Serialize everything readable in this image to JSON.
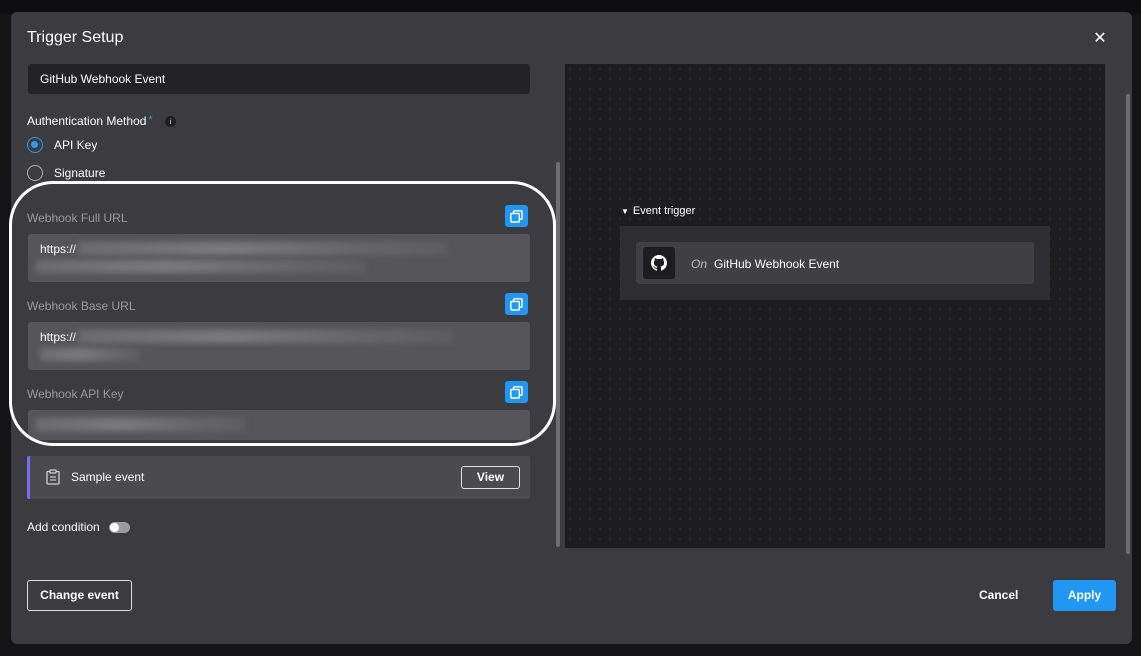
{
  "dialog": {
    "title": "Trigger Setup",
    "close_symbol": "✕"
  },
  "trigger_name": "GitHub Webhook Event",
  "auth": {
    "label": "Authentication Method",
    "required_mark": "*",
    "info_symbol": "i",
    "options": [
      {
        "label": "API Key",
        "selected": true
      },
      {
        "label": "Signature",
        "selected": false
      }
    ]
  },
  "webhook": {
    "full_url": {
      "label": "Webhook Full URL",
      "value": "https://"
    },
    "base_url": {
      "label": "Webhook Base URL",
      "value": "https://"
    },
    "api_key": {
      "label": "Webhook API Key"
    }
  },
  "sample_event": {
    "label": "Sample event",
    "view_label": "View"
  },
  "condition": {
    "label": "Add condition",
    "enabled": false
  },
  "canvas": {
    "section_label": "Event trigger",
    "card_prefix": "On",
    "card_name": "GitHub Webhook Event",
    "icon": "github-icon"
  },
  "footer": {
    "change_label": "Change event",
    "cancel_label": "Cancel",
    "apply_label": "Apply"
  },
  "colors": {
    "accent": "#2196f3",
    "modal_bg": "#3b3b40",
    "canvas_bg": "#1d1d20",
    "sample_border": "#7a6cf0"
  }
}
